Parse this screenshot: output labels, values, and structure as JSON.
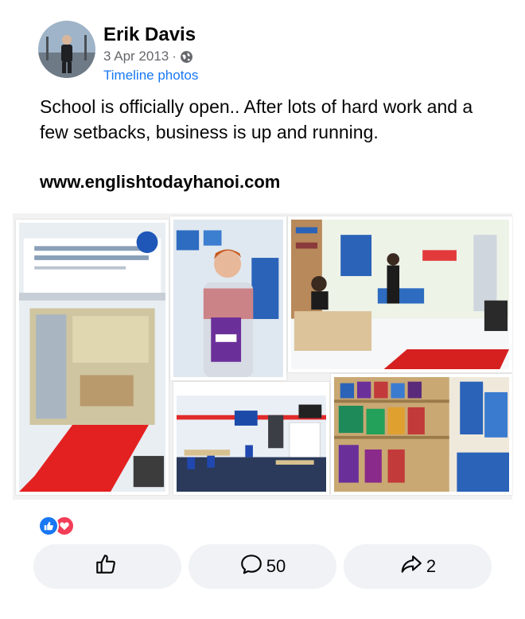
{
  "post": {
    "author": "Erik Davis",
    "date": "3 Apr 2013",
    "separator": "·",
    "album": "Timeline photos",
    "text": "School is officially open.. After lots of hard work and a few setbacks, business is up and running.",
    "url": "www.englishtodayhanoi.com"
  },
  "reactions": [
    "like",
    "love"
  ],
  "actions": {
    "like": {
      "icon": "thumbs-up-icon"
    },
    "comment": {
      "icon": "comment-icon",
      "count": "50"
    },
    "share": {
      "icon": "share-icon",
      "count": "2"
    }
  },
  "colors": {
    "link": "#1877f2",
    "like": "#1877f2",
    "love": "#f33e58",
    "button_bg": "#f0f2f5",
    "meta": "#65676b"
  }
}
